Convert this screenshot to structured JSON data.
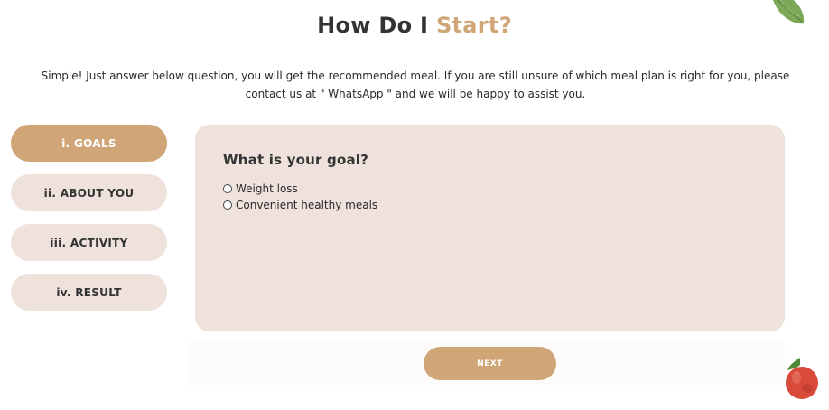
{
  "heading": {
    "part1": "How Do I",
    "part2": "Start?"
  },
  "intro": "Simple! Just answer below question, you will get the recommended meal. If you are still unsure of which meal plan is right for you, please contact us at \" WhatsApp \" and we will be happy to assist you.",
  "steps": [
    {
      "label": "i. GOALS",
      "active": true
    },
    {
      "label": "ii. ABOUT YOU",
      "active": false
    },
    {
      "label": "iii. ACTIVITY",
      "active": false
    },
    {
      "label": "iv. RESULT",
      "active": false
    }
  ],
  "question": {
    "title": "What is your goal?",
    "options": [
      {
        "label": "Weight loss",
        "selected": false
      },
      {
        "label": "Convenient healthy meals",
        "selected": false
      }
    ]
  },
  "next_button": "NEXT",
  "colors": {
    "accent": "#d0a678",
    "panel": "#efe2dd",
    "text": "#333333"
  },
  "decorations": {
    "top_right": "leaf-icon",
    "bottom_right": "tomato-icon"
  }
}
